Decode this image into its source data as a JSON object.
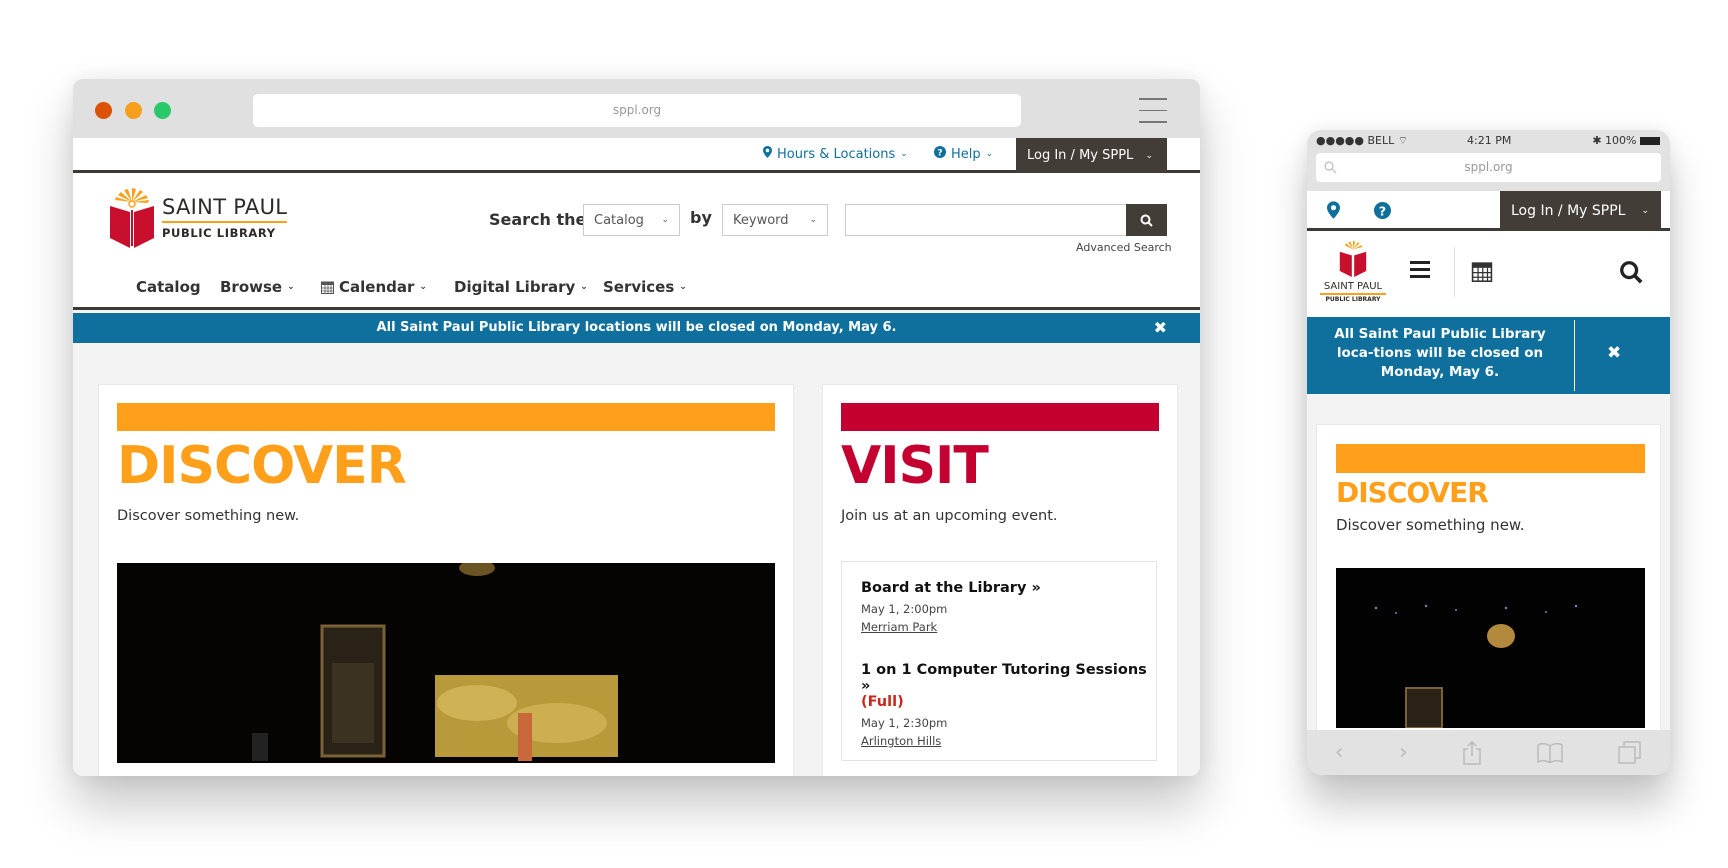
{
  "desktop": {
    "url": "sppl.org",
    "utility": {
      "hours_label": "Hours & Locations",
      "help_label": "Help",
      "login_label": "Log In / My SPPL"
    },
    "logo": {
      "line1": "SAINT PAUL",
      "line2": "PUBLIC LIBRARY"
    },
    "search": {
      "prefix": "Search the",
      "scope_value": "Catalog",
      "by_label": "by",
      "type_value": "Keyword",
      "query_value": "",
      "advanced_label": "Advanced Search"
    },
    "nav": [
      {
        "label": "Catalog"
      },
      {
        "label": "Browse"
      },
      {
        "label": "Calendar"
      },
      {
        "label": "Digital Library"
      },
      {
        "label": "Services"
      }
    ],
    "alert": "All Saint Paul Public Library locations will be closed on Monday, May 6.",
    "discover": {
      "title": "DISCOVER",
      "subtitle": "Discover something new."
    },
    "visit": {
      "title": "VISIT",
      "subtitle": "Join us at an upcoming event.",
      "events": [
        {
          "title": "Board at the Library",
          "date": "May 1, 2:00pm",
          "location": "Merriam Park",
          "status": ""
        },
        {
          "title": "1 on 1 Computer Tutoring Sessions",
          "date": "May 1, 2:30pm",
          "location": "Arlington Hills",
          "status": "(Full)"
        }
      ]
    }
  },
  "phone": {
    "status": {
      "carrier": "BELL",
      "time": "4:21 PM",
      "battery": "100%"
    },
    "url": "sppl.org",
    "login_label": "Log In / My SPPL",
    "logo": {
      "line1": "SAINT PAUL",
      "line2": "PUBLIC LIBRARY"
    },
    "alert": "All Saint Paul Public Library loca-tions will be closed on Monday, May 6.",
    "discover": {
      "title": "DISCOVER",
      "subtitle": "Discover something new."
    }
  },
  "colors": {
    "accent_blue": "#0f6f9d",
    "orange": "#ff9f1a",
    "red": "#c3002f",
    "dark": "#433d38"
  }
}
